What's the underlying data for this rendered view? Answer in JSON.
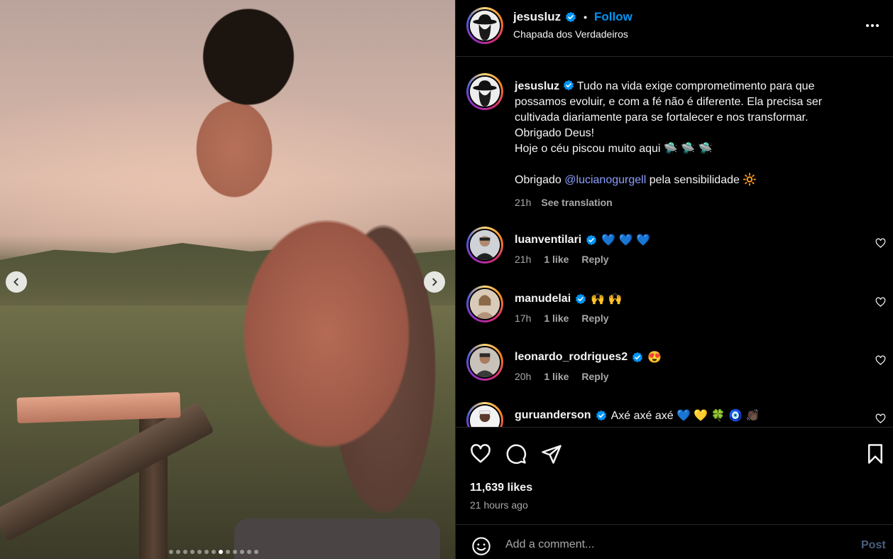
{
  "post": {
    "username": "jesusluz",
    "follow_label": "Follow",
    "bullet": "•",
    "location": "Chapada dos Verdadeiros",
    "caption_lines": [
      "Tudo na vida exige comprometimento para que",
      "possamos evoluir, e com a fé não é diferente. Ela precisa ser",
      "cultivada diariamente para se fortalecer e nos transformar.",
      "Obrigado Deus!",
      "Hoje o céu piscou muito aqui 🛸 🛸 🛸",
      "",
      "Obrigado "
    ],
    "caption_mention": "@lucianogurgell",
    "caption_tail": " pela sensibilidade 🔆",
    "caption_age": "21h",
    "see_translation": "See translation"
  },
  "comments": [
    {
      "username": "luanventilari",
      "text": "💙 💙 💙",
      "age": "21h",
      "likes": "1 like",
      "reply": "Reply"
    },
    {
      "username": "manudelai",
      "text": "🙌 🙌",
      "age": "17h",
      "likes": "1 like",
      "reply": "Reply"
    },
    {
      "username": "leonardo_rodrigues2",
      "text": "😍",
      "age": "20h",
      "likes": "1 like",
      "reply": "Reply"
    },
    {
      "username": "guruanderson",
      "text": "Axé axé axé 💙 💛 🍀 🧿 👏🏿",
      "age": "",
      "likes": "",
      "reply": ""
    }
  ],
  "stats": {
    "likes": "11,639 likes",
    "time_ago": "21 hours ago"
  },
  "composer": {
    "placeholder": "Add a comment...",
    "post_label": "Post"
  },
  "carousel": {
    "total": 13,
    "active_index": 7
  },
  "colors": {
    "accent": "#0095f6",
    "mention": "#8c9eff",
    "muted": "#a8a8a8",
    "post_disabled": "#4a5f80"
  },
  "icons": {
    "prev": "chevron-left-icon",
    "next": "chevron-right-icon",
    "like": "heart-icon",
    "comment": "comment-icon",
    "share": "paper-plane-icon",
    "save": "bookmark-icon",
    "emoji": "smiley-icon",
    "more": "more-icon",
    "verified": "verified-badge-icon"
  }
}
